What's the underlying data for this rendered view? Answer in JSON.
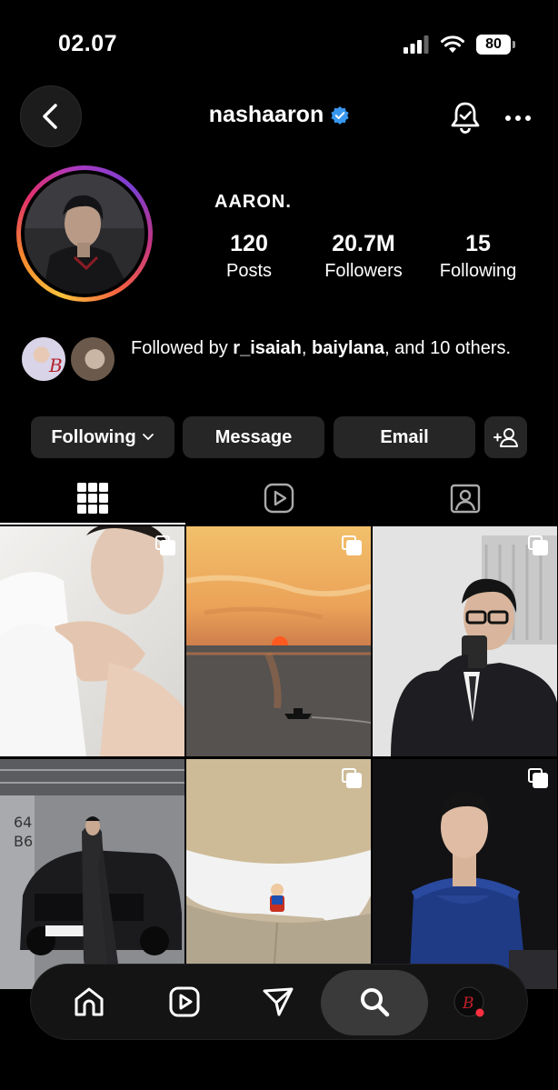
{
  "status_bar": {
    "time": "02.07",
    "battery": "80"
  },
  "header": {
    "username": "nashaaron",
    "verified": true
  },
  "profile": {
    "display_name": "AARON.",
    "stats": [
      {
        "value": "120",
        "label": "Posts"
      },
      {
        "value": "20.7M",
        "label": "Followers"
      },
      {
        "value": "15",
        "label": "Following"
      }
    ],
    "followed_by": {
      "prefix": "Followed by ",
      "user1": "r_isaiah",
      "sep": ", ",
      "user2": "baiylana",
      "suffix": ", and 10 others."
    }
  },
  "actions": {
    "following": "Following",
    "message": "Message",
    "email": "Email"
  },
  "tabs": [
    "grid-icon",
    "reels-icon",
    "tagged-icon"
  ],
  "colors": {
    "background": "#000000",
    "button": "#262626",
    "verified": "#3897f0",
    "notification_dot": "#ff3040"
  }
}
